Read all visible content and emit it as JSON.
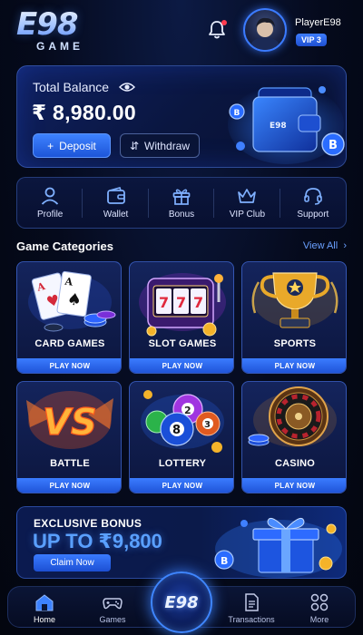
{
  "header": {
    "logo_mark": "E98",
    "logo_sub": "GAME",
    "player_name": "PlayerE98",
    "vip_level": "VIP 3"
  },
  "balance": {
    "label": "Total Balance",
    "amount": "₹ 8,980.00",
    "deposit_label": "Deposit",
    "withdraw_label": "Withdraw"
  },
  "quick_menu": [
    {
      "label": "Profile",
      "icon": "user-icon"
    },
    {
      "label": "Wallet",
      "icon": "wallet-icon"
    },
    {
      "label": "Bonus",
      "icon": "gift-icon"
    },
    {
      "label": "VIP Club",
      "icon": "crown-icon"
    },
    {
      "label": "Support",
      "icon": "headset-icon"
    }
  ],
  "games_section": {
    "title": "Game Categories",
    "view_all": "View All"
  },
  "games": [
    {
      "name": "CARD GAMES",
      "play": "PLAY NOW",
      "icon": "playing-cards-icon"
    },
    {
      "name": "SLOT GAMES",
      "play": "PLAY NOW",
      "icon": "slot-machine-icon"
    },
    {
      "name": "SPORTS",
      "play": "PLAY NOW",
      "icon": "trophy-icon"
    },
    {
      "name": "BATTLE",
      "play": "PLAY NOW",
      "icon": "vs-icon"
    },
    {
      "name": "LOTTERY",
      "play": "PLAY NOW",
      "icon": "lottery-balls-icon"
    },
    {
      "name": "CASINO",
      "play": "PLAY NOW",
      "icon": "roulette-icon"
    }
  ],
  "bonus": {
    "title": "EXCLUSIVE BONUS",
    "amount": "UP TO ₹9,800",
    "claim_label": "Claim Now"
  },
  "bottom_nav": {
    "home": "Home",
    "games": "Games",
    "center": "E98",
    "transactions": "Transactions",
    "more": "More"
  },
  "colors": {
    "accent": "#3b7cff",
    "background": "#050a1c",
    "notification": "#ff3b4f"
  }
}
